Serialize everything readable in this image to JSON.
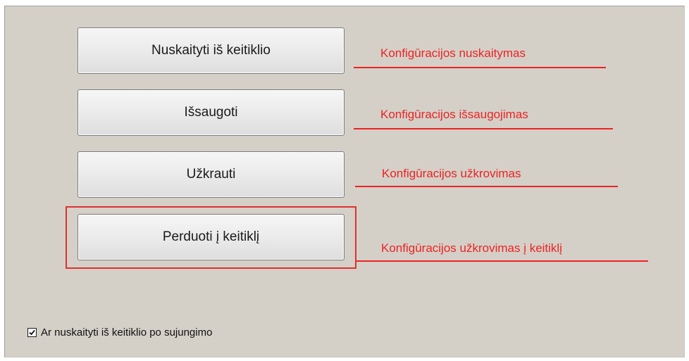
{
  "buttons": {
    "read": "Nuskaityti iš keitiklio",
    "save": "Išsaugoti",
    "load": "Užkrauti",
    "send": "Perduoti į keitiklį"
  },
  "annotations": {
    "read": "Konfigūracijos nuskaitymas",
    "save": "Konfigūracijos išsaugojimas",
    "load": "Konfigūracijos užkrovimas",
    "send": "Konfigūracijos užkrovimas į keitiklį"
  },
  "checkbox": {
    "label": "Ar nuskaityti iš keitiklio po sujungimo",
    "checked": true
  },
  "colors": {
    "panel": "#d4d0c8",
    "annotation": "#ee2222"
  }
}
